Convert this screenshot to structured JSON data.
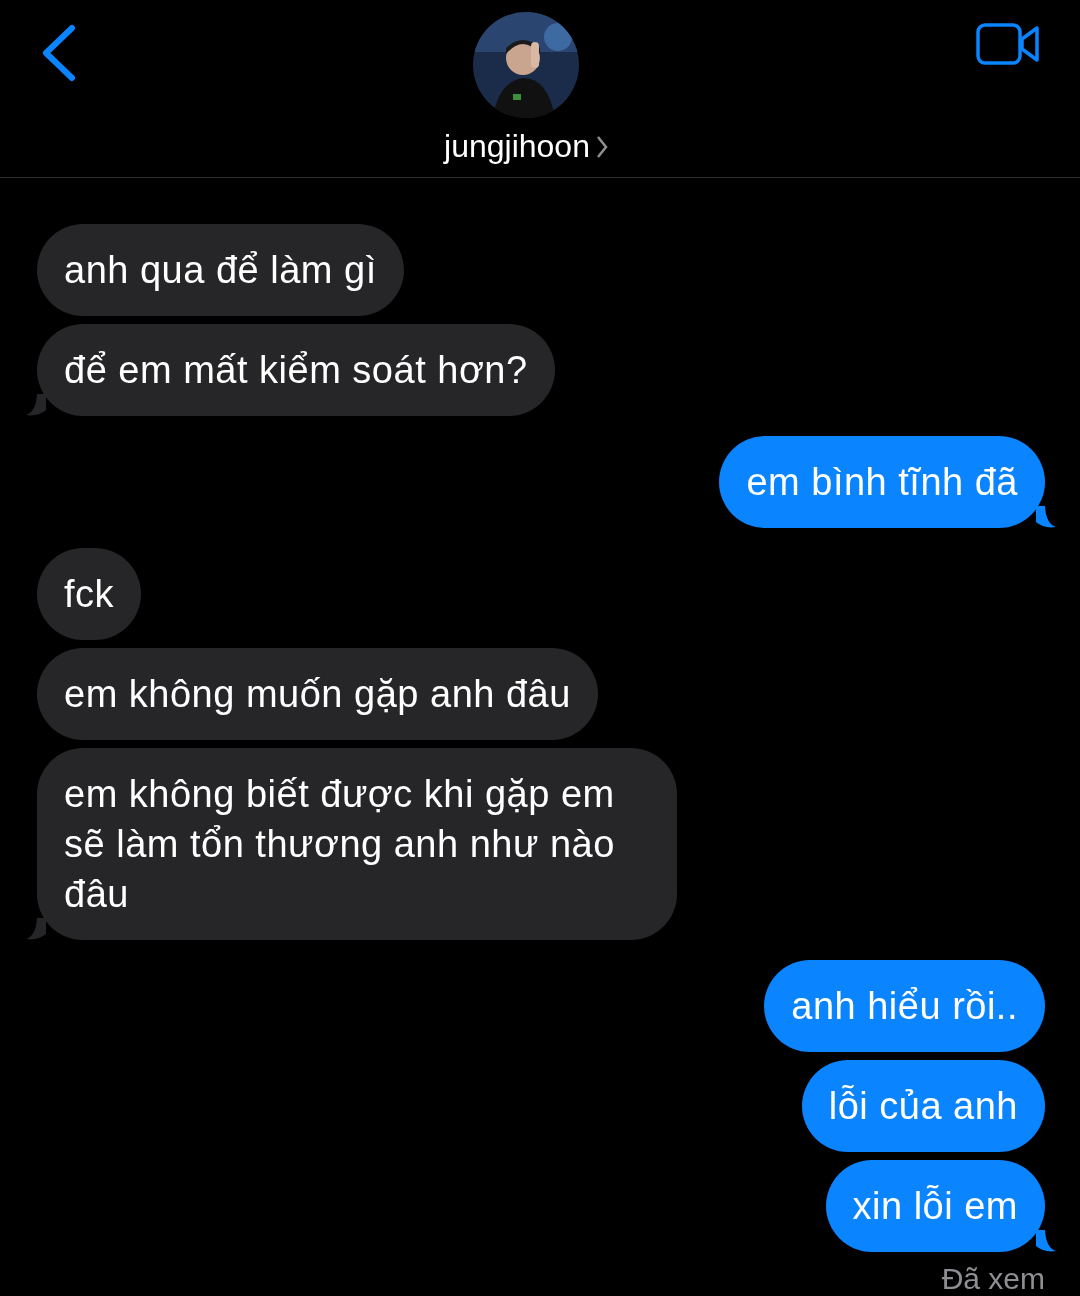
{
  "header": {
    "name": "jungjihoon"
  },
  "messages": [
    {
      "kind": "received",
      "text": "anh qua để làm gì",
      "tail": false
    },
    {
      "kind": "received",
      "text": "để em mất kiểm soát hơn?",
      "tail": true
    },
    {
      "kind": "sent",
      "text": "em bình tĩnh đã",
      "tail": true
    },
    {
      "kind": "received",
      "text": "fck",
      "tail": false
    },
    {
      "kind": "received",
      "text": "em không muốn gặp anh đâu",
      "tail": false
    },
    {
      "kind": "received",
      "text": "em không biết được khi gặp em sẽ làm tổn thương anh như nào đâu",
      "tail": true
    },
    {
      "kind": "sent",
      "text": "anh hiểu rồi..",
      "tail": false
    },
    {
      "kind": "sent",
      "text": "lỗi của anh",
      "tail": false
    },
    {
      "kind": "sent",
      "text": "xin lỗi em",
      "tail": true
    }
  ],
  "status": "Đã xem"
}
